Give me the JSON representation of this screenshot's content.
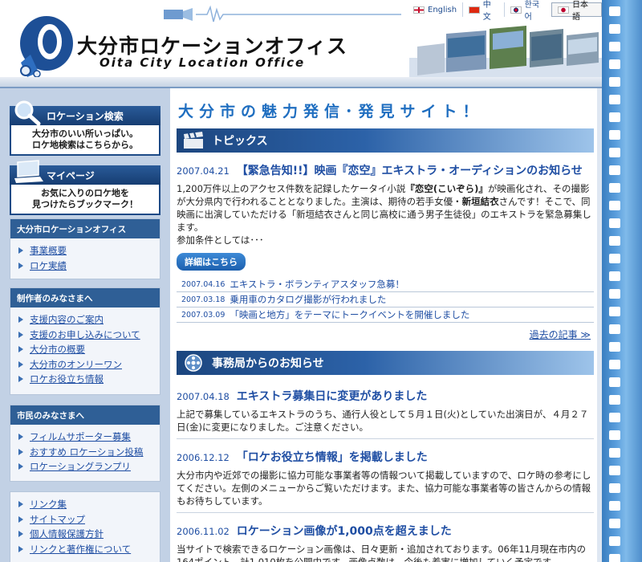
{
  "header": {
    "brand_ja": "大分市ロケーションオフィス",
    "brand_en": "Oita City Location Office",
    "languages": [
      {
        "label": "English",
        "flag": "uk-flag-icon"
      },
      {
        "label": "中文",
        "flag": "china-flag-icon"
      },
      {
        "label": "한국어",
        "flag": "korea-flag-icon"
      },
      {
        "label": "日本語",
        "flag": "japan-flag-icon",
        "active": true
      }
    ]
  },
  "sidebar": {
    "location_search": {
      "title": "ロケーション検索",
      "body_line1": "大分市のいい所いっぱい。",
      "body_line2": "ロケ地検索はこちらから。"
    },
    "mypage": {
      "title": "マイページ",
      "body_line1": "お気に入りのロケ地を",
      "body_line2": "見つけたらブックマーク！"
    },
    "office_menu": {
      "title": "大分市ロケーションオフィス",
      "items": [
        "事業概要",
        "ロケ実績"
      ]
    },
    "producers_menu": {
      "title": "制作者のみなさまへ",
      "items": [
        "支援内容のご案内",
        "支援のお申し込みについて",
        "大分市の概要",
        "大分市のオンリーワン",
        "ロケお役立ち情報"
      ]
    },
    "citizens_menu": {
      "title": "市民のみなさまへ",
      "items": [
        "フィルムサポーター募集",
        "おすすめ ロケーション投稿",
        "ロケーショングランプリ"
      ]
    },
    "links_menu": {
      "items": [
        "リンク集",
        "サイトマップ",
        "個人情報保護方針",
        "リンクと著作権について"
      ]
    }
  },
  "main": {
    "tagline": "大分市の魅力発信･発見サイト！",
    "topics": {
      "title": "トピックス",
      "featured": {
        "date": "2007.04.21",
        "headline": "【緊急告知!!】映画『恋空』エキストラ・オーディションのお知らせ",
        "body_1a": "1,200万件以上のアクセス件数を記録したケータイ小説",
        "body_1b": "『恋空(こいぞら)』",
        "body_1c": "が映画化され、その撮影が大分県内で行われることとなりました。主演は、期待の若手女優・",
        "body_1d": "新垣結衣",
        "body_1e": "さんです！そこで、同映画に出演していただける「新垣結衣さんと同じ高校に通う男子生徒役」のエキストラを緊急募集します。",
        "body_2": "参加条件としては･･･",
        "button": "詳細はこちら"
      },
      "news": [
        {
          "date": "2007.04.16",
          "text": "エキストラ・ボランティアスタッフ急募！"
        },
        {
          "date": "2007.03.18",
          "text": "乗用車のカタログ撮影が行われました"
        },
        {
          "date": "2007.03.09",
          "text": "「映画と地方」をテーマにトークイベントを開催しました"
        }
      ],
      "past_link": "過去の記事 ≫"
    },
    "notices": {
      "title": "事務局からのお知らせ",
      "items": [
        {
          "date": "2007.04.18",
          "headline": "エキストラ募集日に変更がありました",
          "body": "上記で募集しているエキストラのうち、通行人役として５月１日(火)としていた出演日が、４月２７日(金)に変更になりました。ご注意ください。"
        },
        {
          "date": "2006.12.12",
          "headline": "「ロケお役立ち情報」を掲載しました",
          "body": "大分市内や近郊での撮影に協力可能な事業者等の情報ついて掲載していますので、ロケ時の参考にしてください。左側のメニューからご覧いただけます。また、協力可能な事業者等の皆さんからの情報もお待ちしています。"
        },
        {
          "date": "2006.11.02",
          "headline": "ロケーション画像が1,000点を超えました",
          "body": "当サイトで検索できるロケーション画像は、日々更新・追加されております。06年11月現在市内の164ポイント、計1,010枚を公開中です。画像点数は、今後も着実に増加していく予定です。"
        }
      ]
    }
  }
}
